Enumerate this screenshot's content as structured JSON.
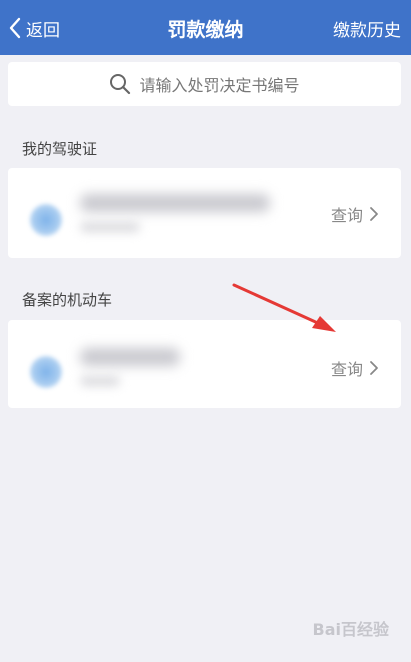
{
  "header": {
    "back_label": "返回",
    "title": "罚款缴纳",
    "history_label": "缴款历史"
  },
  "search": {
    "placeholder": "请输入处罚决定书编号"
  },
  "sections": [
    {
      "label": "我的驾驶证",
      "action_label": "查询"
    },
    {
      "label": "备案的机动车",
      "action_label": "查询"
    }
  ],
  "watermark": "Bai百经验",
  "colors": {
    "header_bg": "#3f73c9",
    "page_bg": "#f0f0f5",
    "annotation_arrow": "#e53935"
  },
  "icons": [
    "chevron-left-icon",
    "search-icon",
    "chevron-right-icon"
  ]
}
